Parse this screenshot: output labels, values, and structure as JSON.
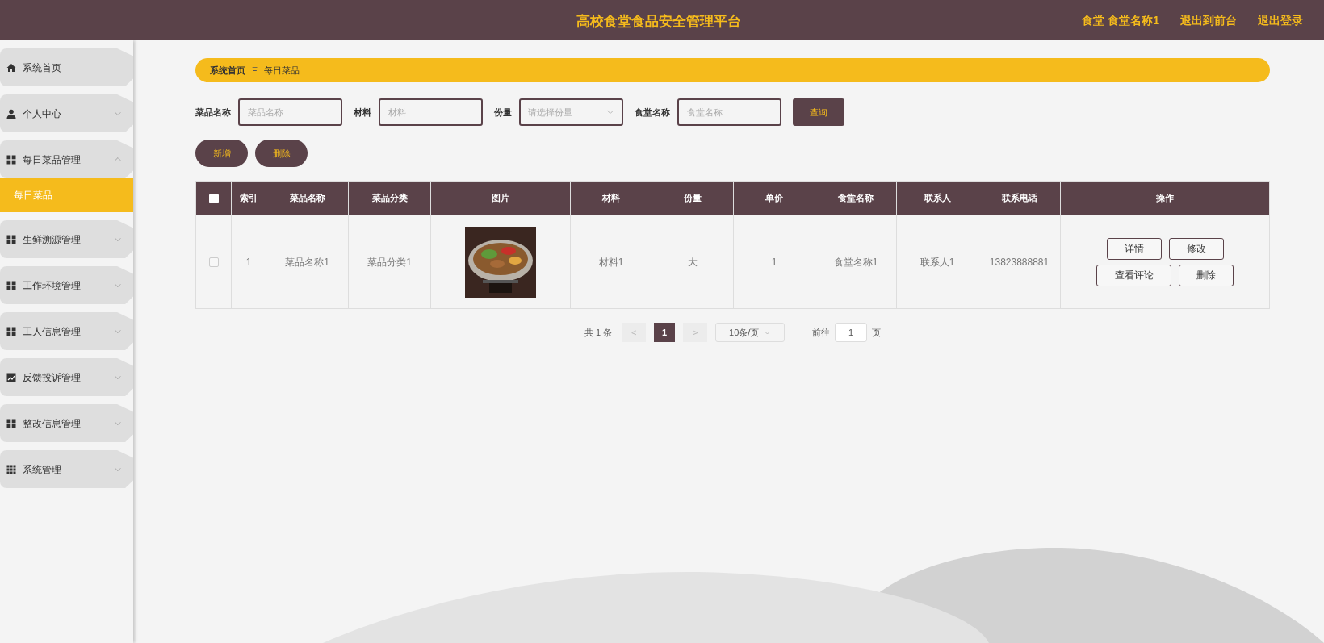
{
  "header": {
    "title": "高校食堂食品安全管理平台",
    "links": [
      "食堂 食堂名称1",
      "退出到前台",
      "退出登录"
    ]
  },
  "sidebar": {
    "items": [
      {
        "label": "系统首页"
      },
      {
        "label": "个人中心",
        "expanded": false
      },
      {
        "label": "每日菜品管理",
        "expanded": true,
        "children": [
          {
            "label": "每日菜品",
            "selected": true
          }
        ]
      },
      {
        "label": "生鲜溯源管理",
        "expanded": false
      },
      {
        "label": "工作环境管理",
        "expanded": false
      },
      {
        "label": "工人信息管理",
        "expanded": false
      },
      {
        "label": "反馈投诉管理",
        "expanded": false
      },
      {
        "label": "整改信息管理",
        "expanded": false
      },
      {
        "label": "系统管理",
        "expanded": false
      }
    ]
  },
  "breadcrumb": {
    "items": [
      "系统首页",
      "每日菜品"
    ],
    "separator": "Ξ"
  },
  "search": {
    "fields": [
      {
        "label": "菜品名称",
        "placeholder": "菜品名称",
        "kind": "text"
      },
      {
        "label": "材料",
        "placeholder": "材料",
        "kind": "text"
      },
      {
        "label": "份量",
        "placeholder": "请选择份量",
        "kind": "select"
      },
      {
        "label": "食堂名称",
        "placeholder": "食堂名称",
        "kind": "text"
      }
    ],
    "button": "查询"
  },
  "actions": [
    "新增",
    "删除"
  ],
  "table": {
    "header_checked": false,
    "columns": [
      "索引",
      "菜品名称",
      "菜品分类",
      "图片",
      "材料",
      "份量",
      "单价",
      "食堂名称",
      "联系人",
      "联系电话",
      "操作"
    ],
    "rows": [
      {
        "checked": false,
        "cells": [
          "1",
          "菜品名称1",
          "菜品分类1",
          {
            "kind": "picture"
          },
          "材料1",
          "大",
          "1",
          "食堂名称1",
          "联系人1",
          "13823888881"
        ],
        "buttons": [
          [
            "详情",
            "修改"
          ],
          [
            "查看评论",
            "删除"
          ]
        ]
      }
    ]
  },
  "pagination": {
    "total": "共 1 条",
    "prev": "<",
    "pages": [
      {
        "label": "1",
        "selected": true
      }
    ],
    "next": ">",
    "page_size": "10条/页",
    "goto": "前往",
    "goto_value": "1",
    "page_unit": "页"
  }
}
